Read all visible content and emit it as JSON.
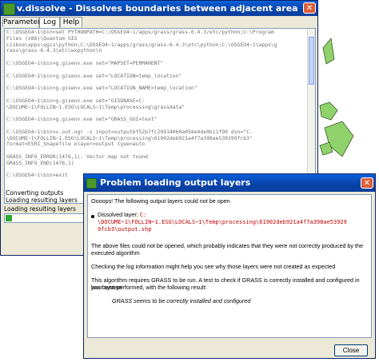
{
  "colors": {
    "titlebar": "#0842a8",
    "map_fill": "#8fd16a",
    "error_text": "#c00000",
    "progress": "#2ea82e"
  },
  "main_window": {
    "title": "v.dissolve - Dissolves boundaries between adjacent areas sharing a common category number ...",
    "icon": "grass-icon",
    "tabs": [
      "Parameters",
      "Log",
      "Help"
    ],
    "log_lines": [
      "C:\\OSGEO4~1\\bin>set PYTHONPATH=C:/OSGEO4~1/apps/grass/grass-6.4.3/etc/python;C:\\Program",
      "Files (x86)\\Quantum GIS",
      "Lisboa\\apps\\qgis\\python;C:\\OSGEO4~1/apps/grass/grass-6.4.3\\etc\\python;C:\\OSGEO4~1\\apps\\g",
      "rass\\grass-6.4.3\\etc\\wxpython\\n",
      "",
      "C:\\OSGEO4~1\\bin>g.gisenv.exe set=\"MAPSET=PERMANENT\"",
      "",
      "C:\\OSGEO4~1\\bin>g.gisenv.exe set=\"LOCATION=temp_location\"",
      "",
      "C:\\OSGEO4~1\\bin>g.gisenv.exe set=\"LOCATION_NAME=temp_location\"",
      "",
      "C:\\OSGEO4~1\\bin>g.gisenv.exe set=\"GISDBASE=C:",
      "\\DOCUME~1\\FOLLIN~1.ESG\\LOCALS~1\\Temp\\processing\\grassdata\"",
      "",
      "C:\\OSGEO4~1\\bin>g.gisenv.exe set=\"GRASS_GUI=text\"",
      "",
      "C:\\OSGEO4~1\\bin>v.out.ogr -s input=output6f52b7fc29914060a058e4de9b11f90 dsn=\"C:",
      "\\DOCUME~1\\FOLLIN~1.ESG\\LOCALS~1\\Temp\\processing\\61902deb921a4f7a398ae539299fcb3\"",
      "format=ESRI_Shapefile olayer=output type=auto",
      "",
      "GRASS_INFO_ERROR(1476,1): Vector map not found",
      "GRASS_INFO_END(1476,1)",
      "",
      "C:\\OSGEO4~1\\bin>exit"
    ],
    "status_lines": [
      "Converting outputs",
      "Loading resulting layers"
    ],
    "loading_label": "Loading resulting layers",
    "progress_fraction": 0.02
  },
  "dialog": {
    "title": "Problem loading output layers",
    "icon": "grass-icon",
    "close_label": "Close",
    "message": {
      "intro": "Oooops! The following output layers could not be open",
      "layer_label": "Dissolved layer:",
      "layer_path_1": "C:",
      "layer_path_2": "\\DOCUME~1\\FOLLIN~1.ESG\\LOCALS~1\\Temp\\processing\\61902deb921a4f7a398ae53929",
      "layer_path_3": "9fcb3\\output.shp",
      "para1_line1": "The above files could not be opened, which probably indicates that they were not correctly produced by the",
      "para1_line2": "executed algorithm",
      "para2": "Checking the log information might help you see why those layers were not created as expected",
      "para3_line1": "This algorithm requires GRASS to be run. A test to check if GRASS is correctly installed and configured in your system",
      "para3_line2": "has been performed, with the following result:",
      "result": "GRASS seems to be correctly installed and configured"
    }
  }
}
